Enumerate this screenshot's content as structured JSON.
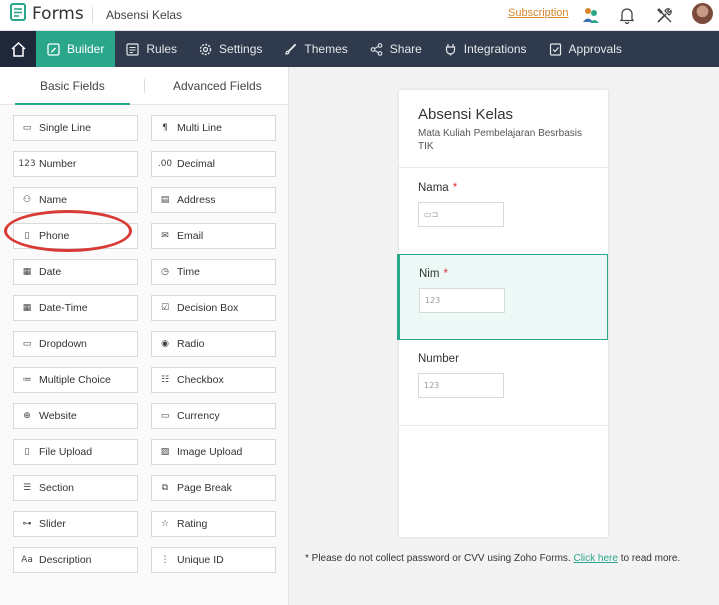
{
  "header": {
    "app_title": "Forms",
    "form_name": "Absensi Kelas",
    "subscription_link": "Subscription"
  },
  "nav": {
    "items": [
      {
        "label": "Builder",
        "icon": "builder-icon"
      },
      {
        "label": "Rules",
        "icon": "rules-icon"
      },
      {
        "label": "Settings",
        "icon": "gear-icon"
      },
      {
        "label": "Themes",
        "icon": "brush-icon"
      },
      {
        "label": "Share",
        "icon": "share-icon"
      },
      {
        "label": "Integrations",
        "icon": "plug-icon"
      },
      {
        "label": "Approvals",
        "icon": "approvals-icon"
      }
    ],
    "active": "Builder"
  },
  "panel": {
    "tabs": [
      "Basic Fields",
      "Advanced Fields"
    ],
    "active_tab": "Basic Fields",
    "fields": [
      {
        "label": "Single Line",
        "icon": "single-line-icon",
        "glyph": "▭"
      },
      {
        "label": "Multi Line",
        "icon": "multi-line-icon",
        "glyph": "¶"
      },
      {
        "label": "Number",
        "icon": "number-icon",
        "glyph": "123"
      },
      {
        "label": "Decimal",
        "icon": "decimal-icon",
        "glyph": ".00"
      },
      {
        "label": "Name",
        "icon": "person-icon",
        "glyph": "⚇"
      },
      {
        "label": "Address",
        "icon": "address-icon",
        "glyph": "▤"
      },
      {
        "label": "Phone",
        "icon": "phone-icon",
        "glyph": "▯"
      },
      {
        "label": "Email",
        "icon": "email-icon",
        "glyph": "✉"
      },
      {
        "label": "Date",
        "icon": "calendar-icon",
        "glyph": "▦"
      },
      {
        "label": "Time",
        "icon": "clock-icon",
        "glyph": "◷"
      },
      {
        "label": "Date-Time",
        "icon": "date-time-icon",
        "glyph": "▦"
      },
      {
        "label": "Decision Box",
        "icon": "checkbox-icon",
        "glyph": "☑"
      },
      {
        "label": "Dropdown",
        "icon": "dropdown-icon",
        "glyph": "▭"
      },
      {
        "label": "Radio",
        "icon": "radio-icon",
        "glyph": "◉"
      },
      {
        "label": "Multiple Choice",
        "icon": "multiple-choice-icon",
        "glyph": "≔"
      },
      {
        "label": "Checkbox",
        "icon": "checklist-icon",
        "glyph": "☷"
      },
      {
        "label": "Website",
        "icon": "globe-icon",
        "glyph": "⊕"
      },
      {
        "label": "Currency",
        "icon": "currency-icon",
        "glyph": "▭"
      },
      {
        "label": "File Upload",
        "icon": "file-icon",
        "glyph": "▯"
      },
      {
        "label": "Image Upload",
        "icon": "image-icon",
        "glyph": "▨"
      },
      {
        "label": "Section",
        "icon": "section-icon",
        "glyph": "☰"
      },
      {
        "label": "Page Break",
        "icon": "page-break-icon",
        "glyph": "⧉"
      },
      {
        "label": "Slider",
        "icon": "slider-icon",
        "glyph": "⊶"
      },
      {
        "label": "Rating",
        "icon": "star-icon",
        "glyph": "☆"
      },
      {
        "label": "Description",
        "icon": "description-icon",
        "glyph": "Aa"
      },
      {
        "label": "Unique ID",
        "icon": "unique-id-icon",
        "glyph": "⋮"
      }
    ]
  },
  "form": {
    "title": "Absensi Kelas",
    "description": "Mata Kuliah Pembelajaran Besrbasis TIK",
    "fields": [
      {
        "label": "Nama",
        "required_mark": "*",
        "placeholder_glyph": "▭⊐",
        "selected": false
      },
      {
        "label": "Nim",
        "required_mark": "*",
        "placeholder_glyph": "123",
        "selected": true
      },
      {
        "label": "Number",
        "required_mark": "",
        "placeholder_glyph": "123",
        "selected": false
      }
    ]
  },
  "footnote": {
    "text": "* Please do not collect password or CVV using Zoho Forms.",
    "link": "Click here",
    "suffix": "to read more."
  },
  "colors": {
    "accent": "#2aa78b",
    "nav_bg": "#2f3a4d",
    "annotation": "#d83a35",
    "subscription": "#d6852b"
  }
}
